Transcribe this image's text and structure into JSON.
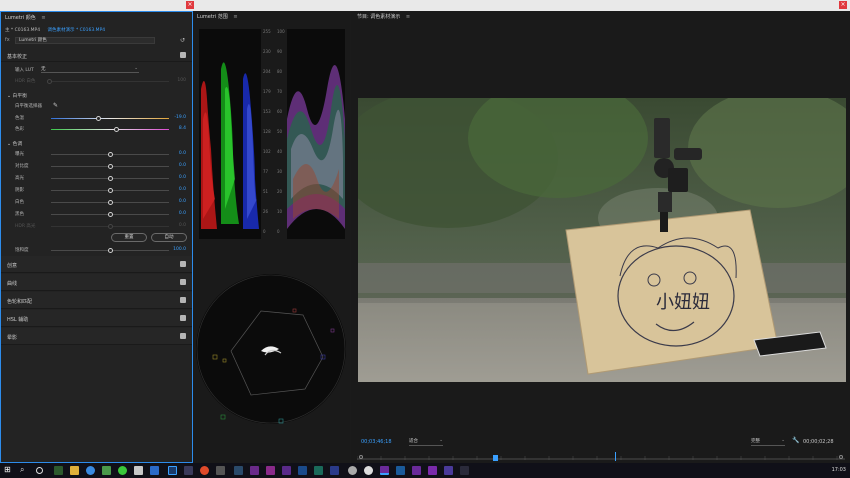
{
  "window": {
    "close_glyph": "×"
  },
  "lumetri": {
    "title": "Lumetri 颜色",
    "menu_glyph": "≡",
    "source": {
      "master": "主 * C0163.MP4",
      "active": "调色素材演示 * C0163.MP4"
    },
    "fx_label": "fx",
    "fx_value": "Lumetri 颜色",
    "basic": {
      "label": "基本校正",
      "input_lut_label": "输入 LUT",
      "input_lut_value": "无",
      "hdr_white_label": "HDR 白色",
      "hdr_white_value": "100",
      "wb_label": "白平衡",
      "wb_selector_label": "白平衡选择器",
      "temp_label": "色温",
      "temp_value": "-19.0",
      "tint_label": "色彩",
      "tint_value": "8.4",
      "tone_label": "色调",
      "exposure_label": "曝光",
      "exposure_value": "0.0",
      "contrast_label": "对比度",
      "contrast_value": "0.0",
      "highlights_label": "高光",
      "highlights_value": "0.0",
      "shadows_label": "阴影",
      "shadows_value": "0.0",
      "whites_label": "白色",
      "whites_value": "0.0",
      "blacks_label": "黑色",
      "blacks_value": "0.0",
      "hdr_spec_label": "HDR 高光",
      "hdr_spec_value": "0.0",
      "reset_label": "重置",
      "auto_label": "自动",
      "saturation_label": "饱和度",
      "saturation_value": "100.0"
    },
    "sections": [
      {
        "label": "创意"
      },
      {
        "label": "曲线"
      },
      {
        "label": "色轮和匹配"
      },
      {
        "label": "HSL 辅助"
      },
      {
        "label": "晕影"
      }
    ]
  },
  "scopes": {
    "title": "Lumetri 范围",
    "menu_glyph": "≡",
    "parade_scale": [
      "255",
      "230",
      "204",
      "179",
      "153",
      "128",
      "102",
      "77",
      "51",
      "26",
      "0"
    ],
    "wave_scale": [
      "100",
      "90",
      "80",
      "70",
      "60",
      "50",
      "40",
      "30",
      "20",
      "10",
      "0"
    ]
  },
  "program": {
    "title": "节目: 调色素材演示",
    "menu_glyph": "≡",
    "timecode": "00;03;46;18",
    "fit_value": "适合",
    "resolution_value": "完整",
    "duration": "00;00;02;28",
    "drawing_text": "小妞妞"
  },
  "taskbar": {
    "time": "17:03"
  },
  "colors": {
    "accent": "#3aa0ff",
    "close": "#e0393e"
  }
}
